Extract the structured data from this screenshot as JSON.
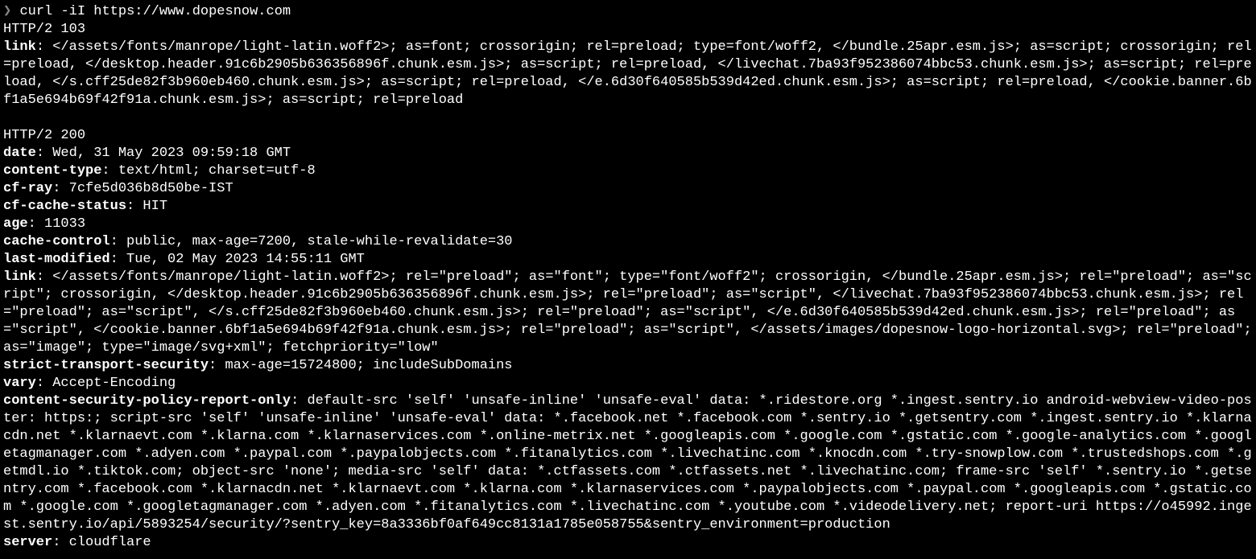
{
  "prompt": "❯",
  "command": "curl -iI https://www.dopesnow.com",
  "resp103": {
    "status": "HTTP/2 103",
    "headers": [
      {
        "name": "link",
        "value": ": </assets/fonts/manrope/light-latin.woff2>; as=font; crossorigin; rel=preload; type=font/woff2, </bundle.25apr.esm.js>; as=script; crossorigin; rel=preload, </desktop.header.91c6b2905b636356896f.chunk.esm.js>; as=script; rel=preload, </livechat.7ba93f952386074bbc53.chunk.esm.js>; as=script; rel=preload, </s.cff25de82f3b960eb460.chunk.esm.js>; as=script; rel=preload, </e.6d30f640585b539d42ed.chunk.esm.js>; as=script; rel=preload, </cookie.banner.6bf1a5e694b69f42f91a.chunk.esm.js>; as=script; rel=preload"
      }
    ]
  },
  "resp200": {
    "status": "HTTP/2 200",
    "headers": [
      {
        "name": "date",
        "value": ": Wed, 31 May 2023 09:59:18 GMT"
      },
      {
        "name": "content-type",
        "value": ": text/html; charset=utf-8"
      },
      {
        "name": "cf-ray",
        "value": ": 7cfe5d036b8d50be-IST"
      },
      {
        "name": "cf-cache-status",
        "value": ": HIT"
      },
      {
        "name": "age",
        "value": ": 11033"
      },
      {
        "name": "cache-control",
        "value": ": public, max-age=7200, stale-while-revalidate=30"
      },
      {
        "name": "last-modified",
        "value": ": Tue, 02 May 2023 14:55:11 GMT"
      },
      {
        "name": "link",
        "value": ": </assets/fonts/manrope/light-latin.woff2>; rel=\"preload\"; as=\"font\"; type=\"font/woff2\"; crossorigin, </bundle.25apr.esm.js>; rel=\"preload\"; as=\"script\"; crossorigin, </desktop.header.91c6b2905b636356896f.chunk.esm.js>; rel=\"preload\"; as=\"script\", </livechat.7ba93f952386074bbc53.chunk.esm.js>; rel=\"preload\"; as=\"script\", </s.cff25de82f3b960eb460.chunk.esm.js>; rel=\"preload\"; as=\"script\", </e.6d30f640585b539d42ed.chunk.esm.js>; rel=\"preload\"; as=\"script\", </cookie.banner.6bf1a5e694b69f42f91a.chunk.esm.js>; rel=\"preload\"; as=\"script\", </assets/images/dopesnow-logo-horizontal.svg>; rel=\"preload\"; as=\"image\"; type=\"image/svg+xml\"; fetchpriority=\"low\""
      },
      {
        "name": "strict-transport-security",
        "value": ": max-age=15724800; includeSubDomains"
      },
      {
        "name": "vary",
        "value": ": Accept-Encoding"
      },
      {
        "name": "content-security-policy-report-only",
        "value": ": default-src 'self' 'unsafe-inline' 'unsafe-eval' data: *.ridestore.org *.ingest.sentry.io android-webview-video-poster: https:; script-src 'self' 'unsafe-inline' 'unsafe-eval' data: *.facebook.net *.facebook.com *.sentry.io *.getsentry.com *.ingest.sentry.io *.klarnacdn.net *.klarnaevt.com *.klarna.com *.klarnaservices.com *.online-metrix.net *.googleapis.com *.google.com *.gstatic.com *.google-analytics.com *.googletagmanager.com *.adyen.com *.paypal.com *.paypalobjects.com *.fitanalytics.com *.livechatinc.com *.knocdn.com *.try-snowplow.com *.trustedshops.com *.getmdl.io *.tiktok.com; object-src 'none'; media-src 'self' data: *.ctfassets.com *.ctfassets.net *.livechatinc.com; frame-src 'self' *.sentry.io *.getsentry.com *.facebook.com *.klarnacdn.net *.klarnaevt.com *.klarna.com *.klarnaservices.com *.paypalobjects.com *.paypal.com *.googleapis.com *.gstatic.com *.google.com *.googletagmanager.com *.adyen.com *.fitanalytics.com *.livechatinc.com *.youtube.com *.videodelivery.net; report-uri https://o45992.ingest.sentry.io/api/5893254/security/?sentry_key=8a3336bf0af649cc8131a1785e058755&sentry_environment=production"
      },
      {
        "name": "server",
        "value": ": cloudflare"
      }
    ]
  }
}
